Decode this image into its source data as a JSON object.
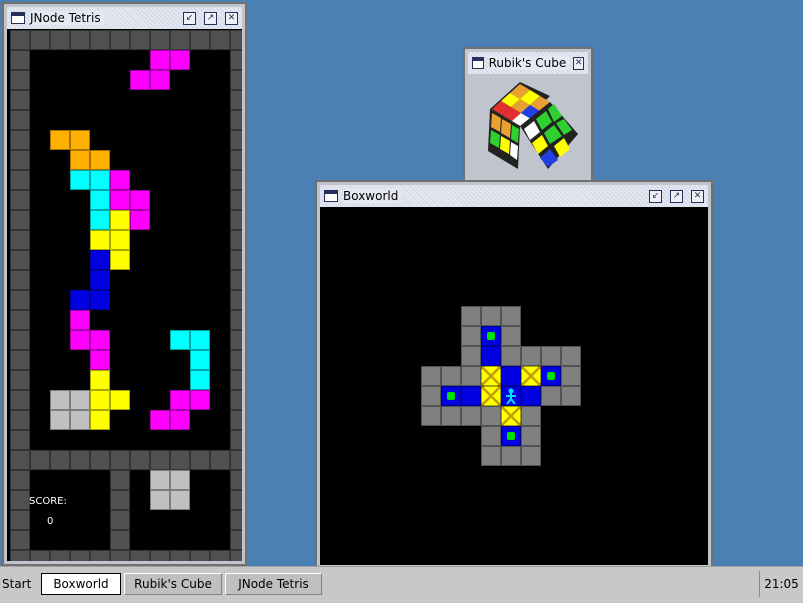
{
  "desktop": {
    "background": "#4a80b4"
  },
  "tetris": {
    "title": "JNode Tetris",
    "score_label": "SCORE:",
    "score_value": "0",
    "colors": {
      "border": "#505050",
      "magenta": "#ff00ff",
      "orange": "#ffb000",
      "cyan": "#00ffff",
      "yellow": "#ffff00",
      "blue": "#0000e0",
      "lightgray": "#c0c0c0"
    },
    "stack": [
      [
        "magenta",
        7,
        1
      ],
      [
        "magenta",
        8,
        1
      ],
      [
        "magenta",
        6,
        2
      ],
      [
        "magenta",
        7,
        2
      ],
      [
        "orange",
        2,
        5
      ],
      [
        "orange",
        3,
        5
      ],
      [
        "orange",
        3,
        6
      ],
      [
        "orange",
        4,
        6
      ],
      [
        "cyan",
        3,
        7
      ],
      [
        "cyan",
        4,
        7
      ],
      [
        "magenta",
        5,
        7
      ],
      [
        "cyan",
        4,
        8
      ],
      [
        "magenta",
        5,
        8
      ],
      [
        "magenta",
        6,
        8
      ],
      [
        "cyan",
        4,
        9
      ],
      [
        "yellow",
        5,
        9
      ],
      [
        "magenta",
        6,
        9
      ],
      [
        "yellow",
        4,
        10
      ],
      [
        "yellow",
        5,
        10
      ],
      [
        "blue",
        4,
        11
      ],
      [
        "yellow",
        5,
        11
      ],
      [
        "blue",
        4,
        12
      ],
      [
        "blue",
        3,
        13
      ],
      [
        "blue",
        4,
        13
      ],
      [
        "magenta",
        3,
        14
      ],
      [
        "magenta",
        3,
        15
      ],
      [
        "magenta",
        4,
        15
      ],
      [
        "cyan",
        8,
        15
      ],
      [
        "cyan",
        9,
        15
      ],
      [
        "magenta",
        4,
        16
      ],
      [
        "cyan",
        9,
        16
      ],
      [
        "yellow",
        4,
        17
      ],
      [
        "cyan",
        9,
        17
      ],
      [
        "lightgray",
        2,
        18
      ],
      [
        "lightgray",
        3,
        18
      ],
      [
        "yellow",
        4,
        18
      ],
      [
        "yellow",
        5,
        18
      ],
      [
        "magenta",
        8,
        18
      ],
      [
        "magenta",
        9,
        18
      ],
      [
        "lightgray",
        2,
        19
      ],
      [
        "lightgray",
        3,
        19
      ],
      [
        "yellow",
        4,
        19
      ],
      [
        "magenta",
        7,
        19
      ],
      [
        "magenta",
        8,
        19
      ]
    ],
    "next_piece": [
      [
        "lightgray",
        7,
        22
      ],
      [
        "lightgray",
        8,
        22
      ],
      [
        "lightgray",
        7,
        23
      ],
      [
        "lightgray",
        8,
        23
      ]
    ]
  },
  "rubik": {
    "title": "Rubik's Cube"
  },
  "boxworld": {
    "title": "Boxworld",
    "colors": {
      "wall": "#808080",
      "floor": "#0000e0",
      "box": "#ffff00",
      "goal": "#00e000",
      "player": "#00e0ff"
    },
    "map": [
      "..WWW...",
      "..WGW...",
      "..WFWWWW",
      "WWWBFBGW",
      "WGFBPFWW",
      "WWWWBW..",
      "...WGW..",
      "...WWW.."
    ]
  },
  "taskbar": {
    "start_label": "Start",
    "tasks": [
      {
        "label": "Boxworld",
        "active": true
      },
      {
        "label": "Rubik's Cube",
        "active": false
      },
      {
        "label": "JNode Tetris",
        "active": false
      }
    ],
    "clock": "21:05"
  }
}
